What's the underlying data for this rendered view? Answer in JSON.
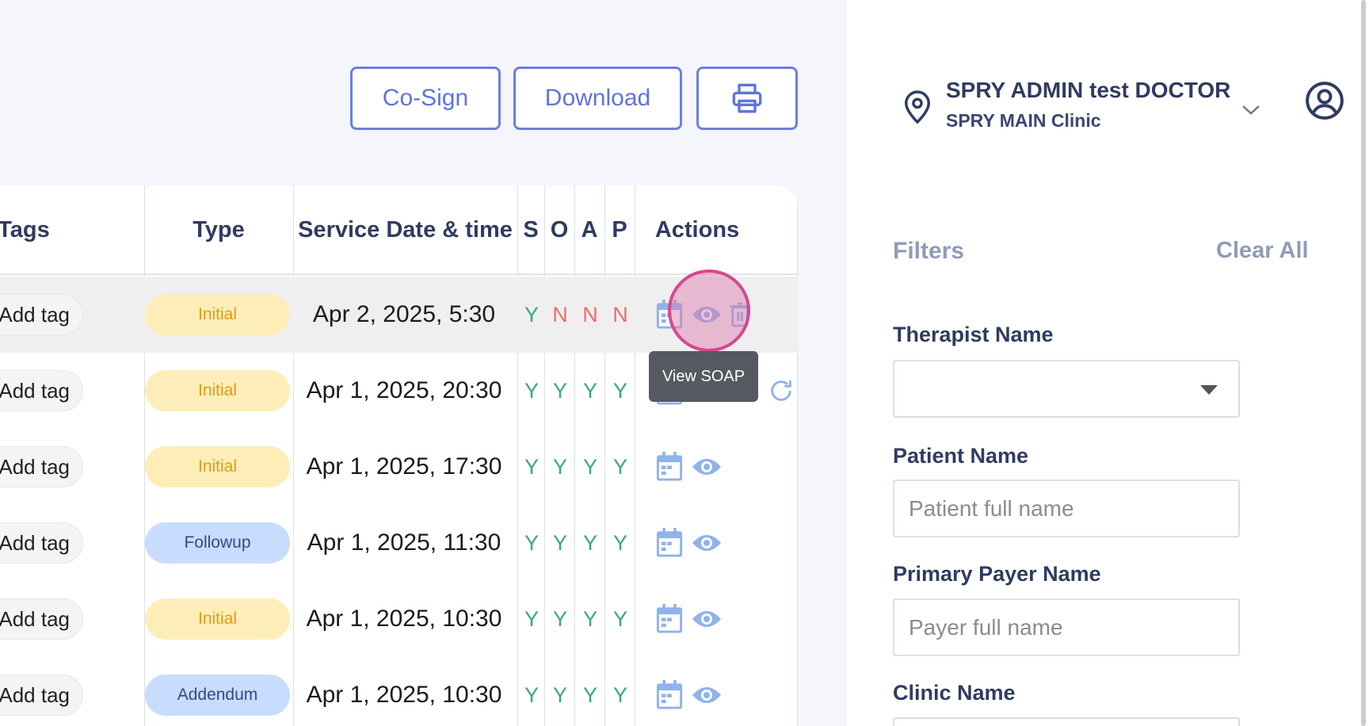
{
  "toolbar": {
    "cosign_label": "Co-Sign",
    "download_label": "Download",
    "print_icon": "printer-icon"
  },
  "table": {
    "headers": {
      "tags": "Tags",
      "type": "Type",
      "service_date": "Service Date & time",
      "s": "S",
      "o": "O",
      "a": "A",
      "p": "P",
      "actions": "Actions"
    },
    "rows": [
      {
        "tag": "Add tag",
        "type": "Initial",
        "date": "Apr 2, 2025, 5:30",
        "s": "Y",
        "o": "N",
        "a": "N",
        "p": "N"
      },
      {
        "tag": "Add tag",
        "type": "Initial",
        "date": "Apr 1, 2025, 20:30",
        "s": "Y",
        "o": "Y",
        "a": "Y",
        "p": "Y"
      },
      {
        "tag": "Add tag",
        "type": "Initial",
        "date": "Apr 1, 2025, 17:30",
        "s": "Y",
        "o": "Y",
        "a": "Y",
        "p": "Y"
      },
      {
        "tag": "Add tag",
        "type": "Followup",
        "date": "Apr 1, 2025, 11:30",
        "s": "Y",
        "o": "Y",
        "a": "Y",
        "p": "Y"
      },
      {
        "tag": "Add tag",
        "type": "Initial",
        "date": "Apr 1, 2025, 10:30",
        "s": "Y",
        "o": "Y",
        "a": "Y",
        "p": "Y"
      },
      {
        "tag": "Add tag",
        "type": "Addendum",
        "date": "Apr 1, 2025, 10:30",
        "s": "Y",
        "o": "Y",
        "a": "Y",
        "p": "Y"
      }
    ],
    "tooltip": "View SOAP"
  },
  "header_user": {
    "name": "SPRY ADMIN test DOCTOR",
    "clinic": "SPRY MAIN Clinic"
  },
  "filters": {
    "title": "Filters",
    "clear_all": "Clear All",
    "therapist_label": "Therapist Name",
    "therapist_value": "",
    "patient_label": "Patient Name",
    "patient_placeholder": "Patient full name",
    "payer_label": "Primary Payer Name",
    "payer_placeholder": "Payer full name",
    "clinic_label": "Clinic Name"
  },
  "colors": {
    "accent": "#6c7fe0",
    "yes": "#3aa97a",
    "no": "#ef6b6b",
    "initial_bg": "#fdeeb9",
    "followup_bg": "#c8dcfd"
  }
}
